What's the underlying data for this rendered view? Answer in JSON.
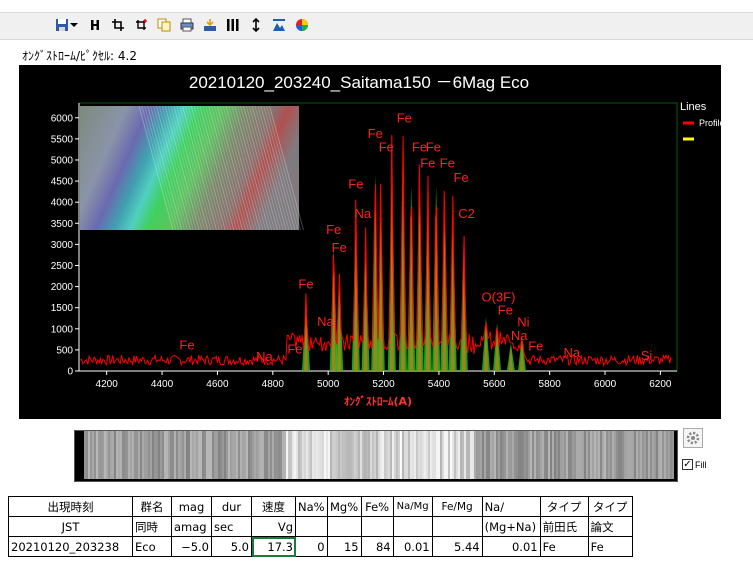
{
  "toolbar": {
    "icons": [
      "save-icon",
      "dropdown-arrow-icon",
      "bold-h-icon",
      "crop-icon",
      "crop-add-icon",
      "copy-icon",
      "print-icon",
      "export-icon",
      "columns-icon",
      "vertical-expand-icon",
      "mountain-icon",
      "color-wheel-icon"
    ]
  },
  "scale_label": "ｵﾝｸﾞｽﾄﾛｰﾑ/ﾋﾟｸｾﾙ: 4.2",
  "chart": {
    "title": "20210120_203240_Saitama150 －6Mag Eco",
    "legend_title": "Lines",
    "legend_items": [
      {
        "name": "Profile",
        "color": "#ff0000"
      },
      {
        "name": "",
        "color": "#ffff00"
      }
    ]
  },
  "chart_data": {
    "type": "line",
    "title": "20210120_203240_Saitama150 －6Mag Eco",
    "xlabel": "ｵﾝｸﾞｽﾄﾛｰﾑ(A)",
    "ylabel": "",
    "xlim": [
      4100,
      6260
    ],
    "ylim": [
      0,
      6350
    ],
    "x_ticks": [
      "4200",
      "4400",
      "4600",
      "4800",
      "5000",
      "5200",
      "5400",
      "5600",
      "5800",
      "6000",
      "6200"
    ],
    "y_ticks": [
      "0",
      "500",
      "1000",
      "1500",
      "2000",
      "2500",
      "3000",
      "3500",
      "4000",
      "4500",
      "5000",
      "5500",
      "6000"
    ],
    "series": [
      {
        "name": "Profile",
        "color": "#ff0000"
      }
    ],
    "peaks": [
      {
        "x": 4920,
        "y": 1950
      },
      {
        "x": 5020,
        "y": 3300
      },
      {
        "x": 5040,
        "y": 2600
      },
      {
        "x": 5100,
        "y": 4300
      },
      {
        "x": 5135,
        "y": 3600
      },
      {
        "x": 5170,
        "y": 5300
      },
      {
        "x": 5190,
        "y": 4700
      },
      {
        "x": 5230,
        "y": 5600
      },
      {
        "x": 5270,
        "y": 5900
      },
      {
        "x": 5300,
        "y": 5000
      },
      {
        "x": 5330,
        "y": 5500
      },
      {
        "x": 5360,
        "y": 4900
      },
      {
        "x": 5390,
        "y": 5000
      },
      {
        "x": 5420,
        "y": 4800
      },
      {
        "x": 5450,
        "y": 4400
      },
      {
        "x": 5490,
        "y": 3600
      },
      {
        "x": 5570,
        "y": 1450
      },
      {
        "x": 5610,
        "y": 1300
      },
      {
        "x": 5660,
        "y": 750
      },
      {
        "x": 5700,
        "y": 950
      }
    ],
    "annotations": [
      {
        "text": "Fe",
        "x": 4490,
        "y": 510
      },
      {
        "text": "Na",
        "x": 4770,
        "y": 240
      },
      {
        "text": "Fe",
        "x": 4880,
        "y": 410
      },
      {
        "text": "Fe",
        "x": 4920,
        "y": 1950
      },
      {
        "text": "Na",
        "x": 4990,
        "y": 1070
      },
      {
        "text": "Fe",
        "x": 5020,
        "y": 3250
      },
      {
        "text": "Fe",
        "x": 5040,
        "y": 2820
      },
      {
        "text": "Fe",
        "x": 5100,
        "y": 4330
      },
      {
        "text": "Na",
        "x": 5125,
        "y": 3630
      },
      {
        "text": "Fe",
        "x": 5170,
        "y": 5520
      },
      {
        "text": "Fe",
        "x": 5210,
        "y": 5200
      },
      {
        "text": "Fe",
        "x": 5275,
        "y": 5890
      },
      {
        "text": "Fe",
        "x": 5330,
        "y": 5200
      },
      {
        "text": "Fe",
        "x": 5380,
        "y": 5200
      },
      {
        "text": "Fe",
        "x": 5360,
        "y": 4820
      },
      {
        "text": "Fe",
        "x": 5430,
        "y": 4820
      },
      {
        "text": "Fe",
        "x": 5480,
        "y": 4480
      },
      {
        "text": "C2",
        "x": 5500,
        "y": 3630
      },
      {
        "text": "O(3F)",
        "x": 5615,
        "y": 1650
      },
      {
        "text": "Fe",
        "x": 5640,
        "y": 1340
      },
      {
        "text": "Ni",
        "x": 5705,
        "y": 1060
      },
      {
        "text": "Na",
        "x": 5690,
        "y": 740
      },
      {
        "text": "Fe",
        "x": 5750,
        "y": 480
      },
      {
        "text": "Na",
        "x": 5880,
        "y": 330
      },
      {
        "text": "Si",
        "x": 6150,
        "y": 260
      }
    ]
  },
  "options": {
    "fill_label": "Fill",
    "fill_checked": true
  },
  "table": {
    "headers": [
      "出現時刻",
      "群名",
      "mag",
      "dur",
      "速度",
      "Na%",
      "Mg%",
      "Fe%",
      "Na/Mg",
      "Fe/Mg",
      "Na/",
      "タイプ",
      "タイプ"
    ],
    "units": [
      "JST",
      "同時",
      "amag",
      "sec",
      "Vg",
      "",
      "",
      "",
      "",
      "",
      "(Mg+Na)",
      "前田氏",
      "論文"
    ],
    "row": [
      "20210120_203238",
      "Eco",
      "−5.0",
      "5.0",
      "17.3",
      "0",
      "15",
      "84",
      "0.01",
      "5.44",
      "0.01",
      "Fe",
      "Fe"
    ]
  }
}
